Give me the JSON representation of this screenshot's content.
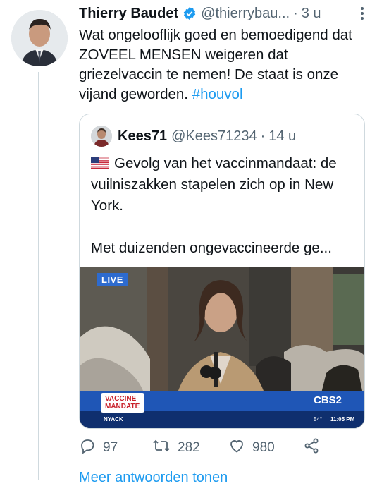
{
  "tweet": {
    "author_name": "Thierry Baudet",
    "handle": "@thierrybau...",
    "separator": "·",
    "time": "3 u",
    "text_main": "Wat ongelooflijk goed en bemoedigend dat ZOVEEL MENSEN weigeren dat griezelvaccin te nemen! De staat is onze vijand geworden.",
    "hashtag": "#houvol"
  },
  "quote": {
    "author_name": "Kees71",
    "handle": "@Kees71234",
    "separator": "·",
    "time": "14 u",
    "line1": "Gevolg van het vaccinmandaat: de vuilniszakken stapelen zich op in New York.",
    "line2": "Met duizenden ongevaccineerde ge...",
    "flag_icon": "us-flag-icon"
  },
  "media": {
    "live_label": "LIVE",
    "lower_third": "VACCINE MANDATE",
    "station": "CBS2",
    "ticker_location": "NYACK",
    "ticker_time": "11:05 PM",
    "ticker_temp": "54°"
  },
  "actions": {
    "replies": "97",
    "retweets": "282",
    "likes": "980"
  },
  "footer": {
    "more_replies": "Meer antwoorden tonen"
  },
  "colors": {
    "accent": "#1d9bf0",
    "muted": "#536471",
    "border": "#cfd9de"
  }
}
